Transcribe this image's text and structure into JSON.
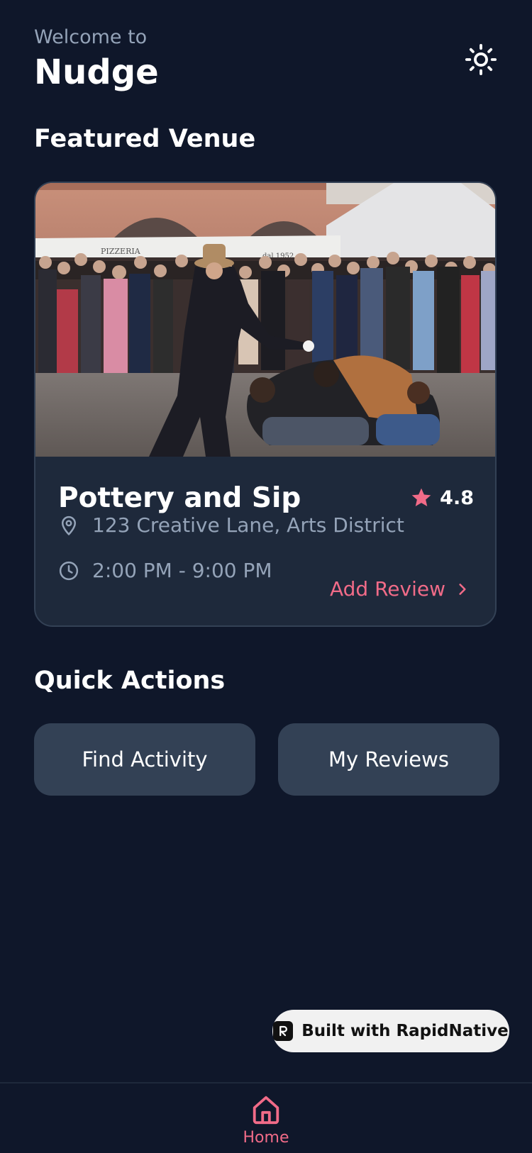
{
  "header": {
    "welcome": "Welcome to",
    "app_name": "Nudge"
  },
  "featured": {
    "section_title": "Featured Venue",
    "venue": {
      "name": "Pottery and Sip",
      "rating": "4.8",
      "address": "123 Creative Lane, Arts District",
      "hours": "2:00 PM - 9:00 PM",
      "add_review_label": "Add Review",
      "image_signs": [
        "PIZZERIA",
        "dal 1952"
      ]
    }
  },
  "quick_actions": {
    "section_title": "Quick Actions",
    "items": [
      {
        "label": "Find Activity"
      },
      {
        "label": "My Reviews"
      }
    ]
  },
  "badge": {
    "label": "Built with RapidNative"
  },
  "tabbar": {
    "home_label": "Home"
  },
  "colors": {
    "background": "#0f172a",
    "card": "#1e293b",
    "button": "#334155",
    "accent": "#f16b88",
    "muted_text": "#94a3b8"
  },
  "icons": [
    "sun-icon",
    "star-icon",
    "map-pin-icon",
    "clock-icon",
    "chevron-right-icon",
    "home-icon"
  ]
}
